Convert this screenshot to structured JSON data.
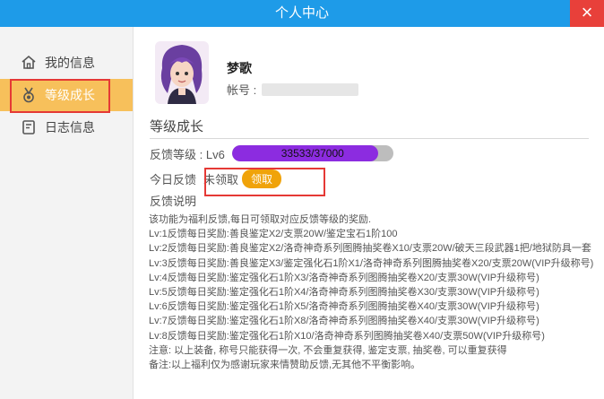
{
  "window": {
    "title": "个人中心",
    "close_label": "×"
  },
  "sidebar": {
    "items": [
      {
        "label": "我的信息",
        "icon": "home-icon"
      },
      {
        "label": "等级成长",
        "icon": "medal-icon",
        "active": true
      },
      {
        "label": "日志信息",
        "icon": "log-icon"
      }
    ]
  },
  "profile": {
    "username": "梦歌",
    "account_label": "帐号 :"
  },
  "level": {
    "section_title": "等级成长",
    "label": "反馈等级 : Lv6",
    "progress_text": "33533/37000",
    "progress_fraction": 0.906,
    "bar_color": "#8c2ce0",
    "daily_label": "今日反馈",
    "daily_status": "未领取",
    "claim_label": "领取",
    "desc_title": "反馈说明",
    "desc_lines": [
      "该功能为福利反馈,每日可领取对应反馈等级的奖励.",
      "Lv:1反馈每日奖励:善良鉴定X2/支票20W/鉴定宝石1阶100",
      "Lv:2反馈每日奖励:善良鉴定X2/洛奇神奇系列图腾抽奖卷X10/支票20W/破天三段武器1把/地狱防具一套",
      "Lv:3反馈每日奖励:善良鉴定X3/鉴定强化石1阶X1/洛奇神奇系列图腾抽奖卷X20/支票20W(VIP升级称号)",
      "Lv:4反馈每日奖励:鉴定强化石1阶X3/洛奇神奇系列图腾抽奖卷X20/支票30W(VIP升级称号)",
      "Lv:5反馈每日奖励:鉴定强化石1阶X4/洛奇神奇系列图腾抽奖卷X30/支票30W(VIP升级称号)",
      "Lv:6反馈每日奖励:鉴定强化石1阶X5/洛奇神奇系列图腾抽奖卷X40/支票30W(VIP升级称号)",
      "Lv:7反馈每日奖励:鉴定强化石1阶X8/洛奇神奇系列图腾抽奖卷X40/支票30W(VIP升级称号)",
      "Lv:8反馈每日奖励:鉴定强化石1阶X10/洛奇神奇系列图腾抽奖卷X40/支票50W(VIP升级称号)",
      "注意: 以上装备, 称号只能获得一次, 不会重复获得, 鉴定支票, 抽奖卷, 可以重复获得",
      "备注:以上福利仅为感谢玩家来情赞助反馈,无其他不平衡影响。"
    ]
  },
  "colors": {
    "titlebar": "#1e9be8",
    "close": "#e8403a",
    "active_nav": "#f7c05b",
    "claim": "#f0a30a",
    "highlight": "#e53935"
  }
}
